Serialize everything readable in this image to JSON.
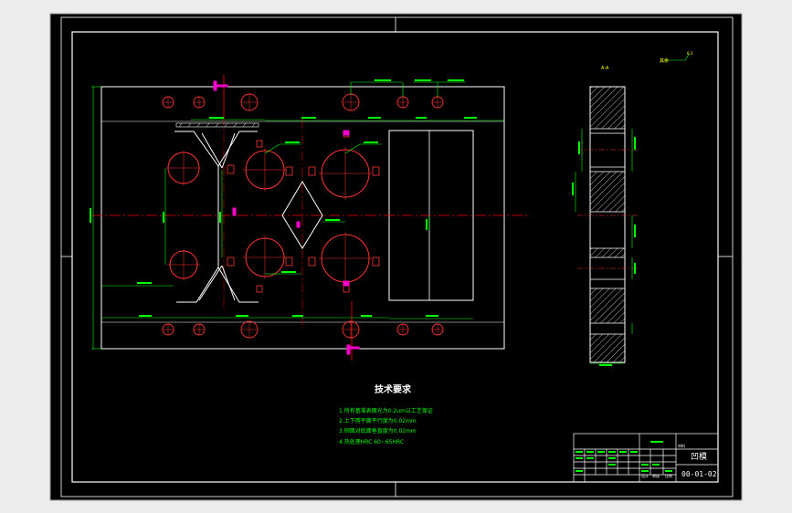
{
  "colors": {
    "background": "#ececec",
    "canvas": "#000000",
    "frame": "#ffffff",
    "outline": "#ffffff",
    "dimension": "#00ff00",
    "center_line": "#ff0000",
    "hole": "#ff3333",
    "hatch": "#ffffff",
    "marker": "#ff00cc",
    "note_title": "#ffffff",
    "note_text": "#00ff00",
    "text_yellow": "#ffff00"
  },
  "section_label": "A-A",
  "roughness_label": "其余",
  "roughness_value": "6.3",
  "notes": {
    "title": "技术要求",
    "items": [
      "1.所有基准表面光为0.2um以工艺保证",
      "2.上下两平面平行度为0.02mm",
      "3.侧面对底面垂直度为0.02mm",
      "4.热处理HRC 60~65HRC"
    ]
  },
  "title_block": {
    "part_name": "凹模",
    "drawing_number": "00-01-02",
    "scale_label": "比例",
    "material_label": "材料",
    "drawn_label": "设计",
    "checked_label": "审核"
  }
}
